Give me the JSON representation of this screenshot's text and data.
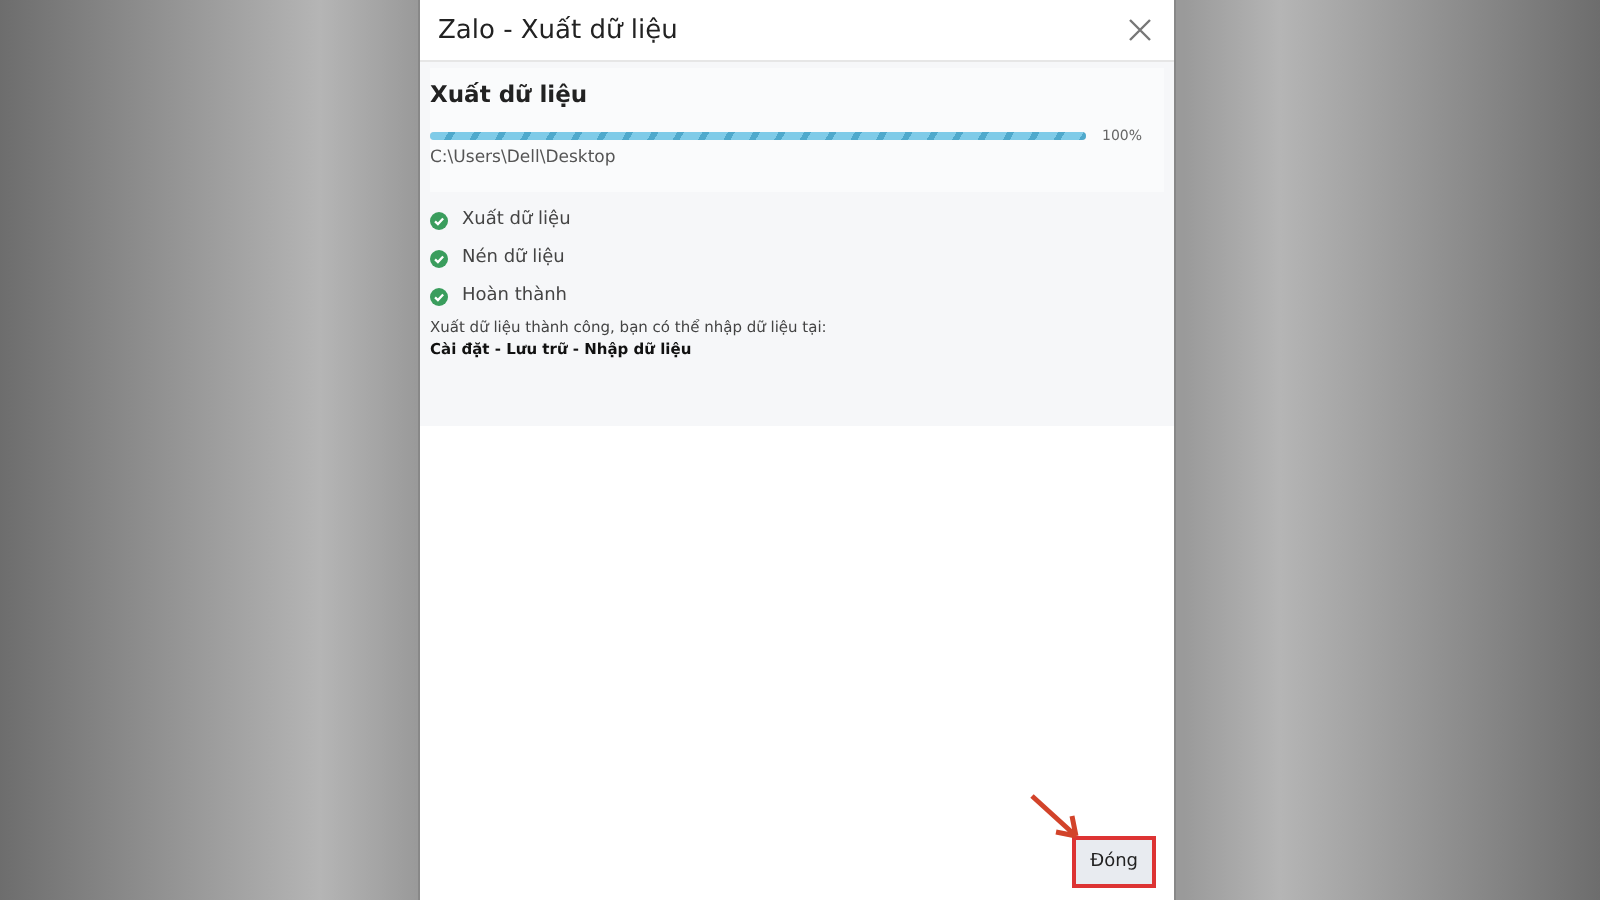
{
  "window": {
    "title": "Zalo - Xuất dữ liệu"
  },
  "export": {
    "heading": "Xuất dữ liệu",
    "level": 1,
    "percent": "100%",
    "path": "C:\\Users\\Dell\\Desktop"
  },
  "steps": [
    {
      "label": "Xuất dữ liệu",
      "done": true
    },
    {
      "label": "Nén dữ liệu",
      "done": true
    },
    {
      "label": "Hoàn thành",
      "done": true
    }
  ],
  "message": "Xuất dữ liệu thành công, bạn có thể nhập dữ liệu tại:",
  "location": "Cài đặt - Lưu trữ - Nhập dữ liệu",
  "close_button": {
    "label": "Đóng",
    "highlighted": true
  }
}
